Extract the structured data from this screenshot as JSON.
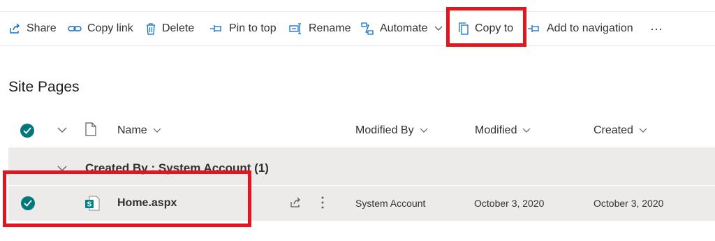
{
  "toolbar": {
    "share": "Share",
    "copy_link": "Copy link",
    "delete": "Delete",
    "pin_to_top": "Pin to top",
    "rename": "Rename",
    "automate": "Automate",
    "copy_to": "Copy to",
    "add_to_navigation": "Add to navigation",
    "more": "···"
  },
  "page": {
    "title": "Site Pages"
  },
  "columns": {
    "name": "Name",
    "modified_by": "Modified By",
    "modified": "Modified",
    "created": "Created"
  },
  "group": {
    "label": "Created By : System Account (1)"
  },
  "rows": [
    {
      "name": "Home.aspx",
      "modified_by": "System Account",
      "modified": "October 3, 2020",
      "created": "October 3, 2020",
      "file_icon": "sharepoint-page-icon"
    }
  ],
  "colors": {
    "accent": "#03787c",
    "highlight": "#e3161f",
    "group_bg": "#edebe9"
  }
}
